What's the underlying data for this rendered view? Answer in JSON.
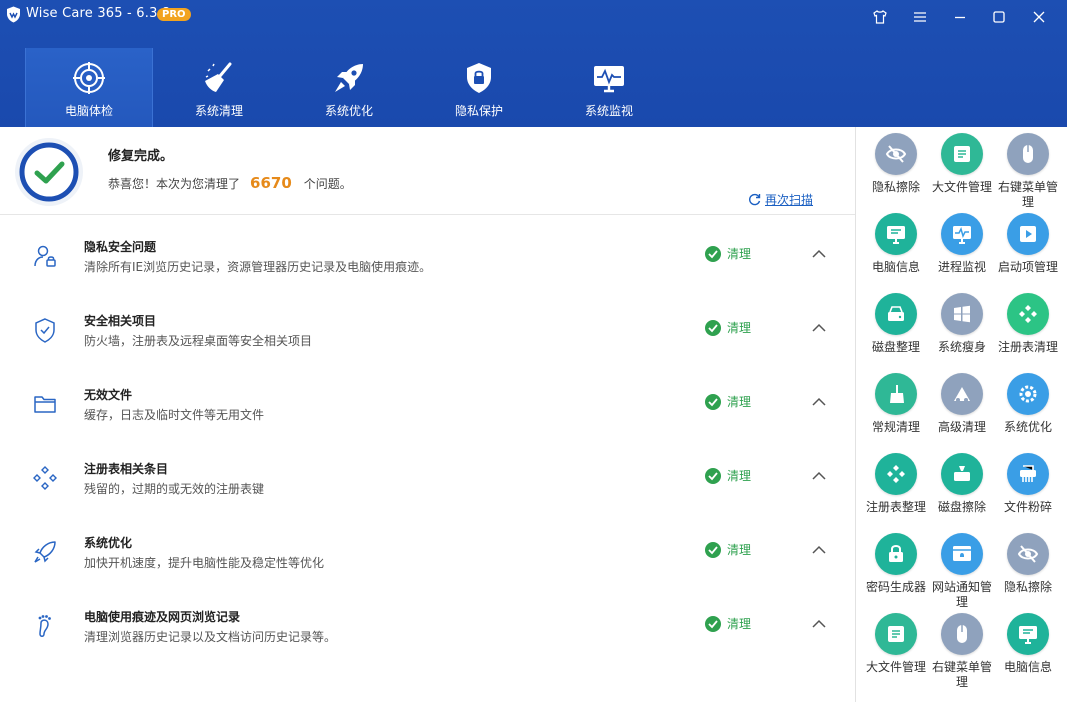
{
  "app": {
    "title": "Wise Care 365 - 6.3.8",
    "badge": "PRO"
  },
  "colors": {
    "header": "#1d4fb3",
    "accent": "#1a5fc2",
    "success": "#2fa14f",
    "count": "#e68a1a"
  },
  "nav": [
    {
      "label": "电脑体检",
      "icon": "target-icon",
      "active": true
    },
    {
      "label": "系统清理",
      "icon": "broom-icon"
    },
    {
      "label": "系统优化",
      "icon": "rocket-icon"
    },
    {
      "label": "隐私保护",
      "icon": "shield-lock-icon"
    },
    {
      "label": "系统监视",
      "icon": "monitor-icon"
    }
  ],
  "result": {
    "title": "修复完成。",
    "prefix": "恭喜您！本次为您清理了",
    "count": "6670",
    "suffix": "个问题。",
    "rescan": "再次扫描"
  },
  "issues": [
    {
      "title": "隐私安全问题",
      "desc": "清除所有IE浏览历史记录，资源管理器历史记录及电脑使用痕迹。",
      "status": "清理",
      "icon": "user-privacy-icon"
    },
    {
      "title": "安全相关项目",
      "desc": "防火墙，注册表及远程桌面等安全相关项目",
      "status": "清理",
      "icon": "shield-check-icon"
    },
    {
      "title": "无效文件",
      "desc": "缓存，日志及临时文件等无用文件",
      "status": "清理",
      "icon": "folder-icon"
    },
    {
      "title": "注册表相关条目",
      "desc": "残留的，过期的或无效的注册表键",
      "status": "清理",
      "icon": "registry-icon"
    },
    {
      "title": "系统优化",
      "desc": "加快开机速度，提升电脑性能及稳定性等优化",
      "status": "清理",
      "icon": "rocket-small-icon"
    },
    {
      "title": "电脑使用痕迹及网页浏览记录",
      "desc": "清理浏览器历史记录以及文档访问历史记录等。",
      "status": "清理",
      "icon": "footprint-icon"
    }
  ],
  "tools": [
    {
      "label": "隐私擦除",
      "color": "#8fa2bd",
      "icon": "eye-off-icon"
    },
    {
      "label": "大文件管理",
      "color": "#2fb896",
      "icon": "big-file-icon"
    },
    {
      "label": "右键菜单管理",
      "color": "#8fa2bd",
      "icon": "mouse-icon"
    },
    {
      "label": "电脑信息",
      "color": "#1fb39a",
      "icon": "pc-info-icon"
    },
    {
      "label": "进程监视",
      "color": "#3a9ee6",
      "icon": "process-monitor-icon"
    },
    {
      "label": "启动项管理",
      "color": "#3a9ee6",
      "icon": "play-icon"
    },
    {
      "label": "磁盘整理",
      "color": "#1fb39a",
      "icon": "disk-icon"
    },
    {
      "label": "系统瘦身",
      "color": "#8fa2bd",
      "icon": "windows-icon"
    },
    {
      "label": "注册表清理",
      "color": "#2cc485",
      "icon": "registry-clean-icon"
    },
    {
      "label": "常规清理",
      "color": "#2fb896",
      "icon": "broom-tool-icon"
    },
    {
      "label": "高级清理",
      "color": "#8fa2bd",
      "icon": "advanced-clean-icon"
    },
    {
      "label": "系统优化",
      "color": "#3a9ee6",
      "icon": "gear-icon"
    },
    {
      "label": "注册表整理",
      "color": "#1fb39a",
      "icon": "registry-defrag-icon"
    },
    {
      "label": "磁盘擦除",
      "color": "#1fb39a",
      "icon": "disk-erase-icon"
    },
    {
      "label": "文件粉碎",
      "color": "#3a9ee6",
      "icon": "shredder-icon"
    },
    {
      "label": "密码生成器",
      "color": "#1fb39a",
      "icon": "lock-icon"
    },
    {
      "label": "网站通知管理",
      "color": "#3a9ee6",
      "icon": "web-notify-icon"
    },
    {
      "label": "隐私擦除",
      "color": "#8fa2bd",
      "icon": "eye-off-icon"
    },
    {
      "label": "大文件管理",
      "color": "#2fb896",
      "icon": "big-file-icon"
    },
    {
      "label": "右键菜单管理",
      "color": "#8fa2bd",
      "icon": "mouse-icon"
    },
    {
      "label": "电脑信息",
      "color": "#1fb39a",
      "icon": "pc-info-icon"
    }
  ]
}
